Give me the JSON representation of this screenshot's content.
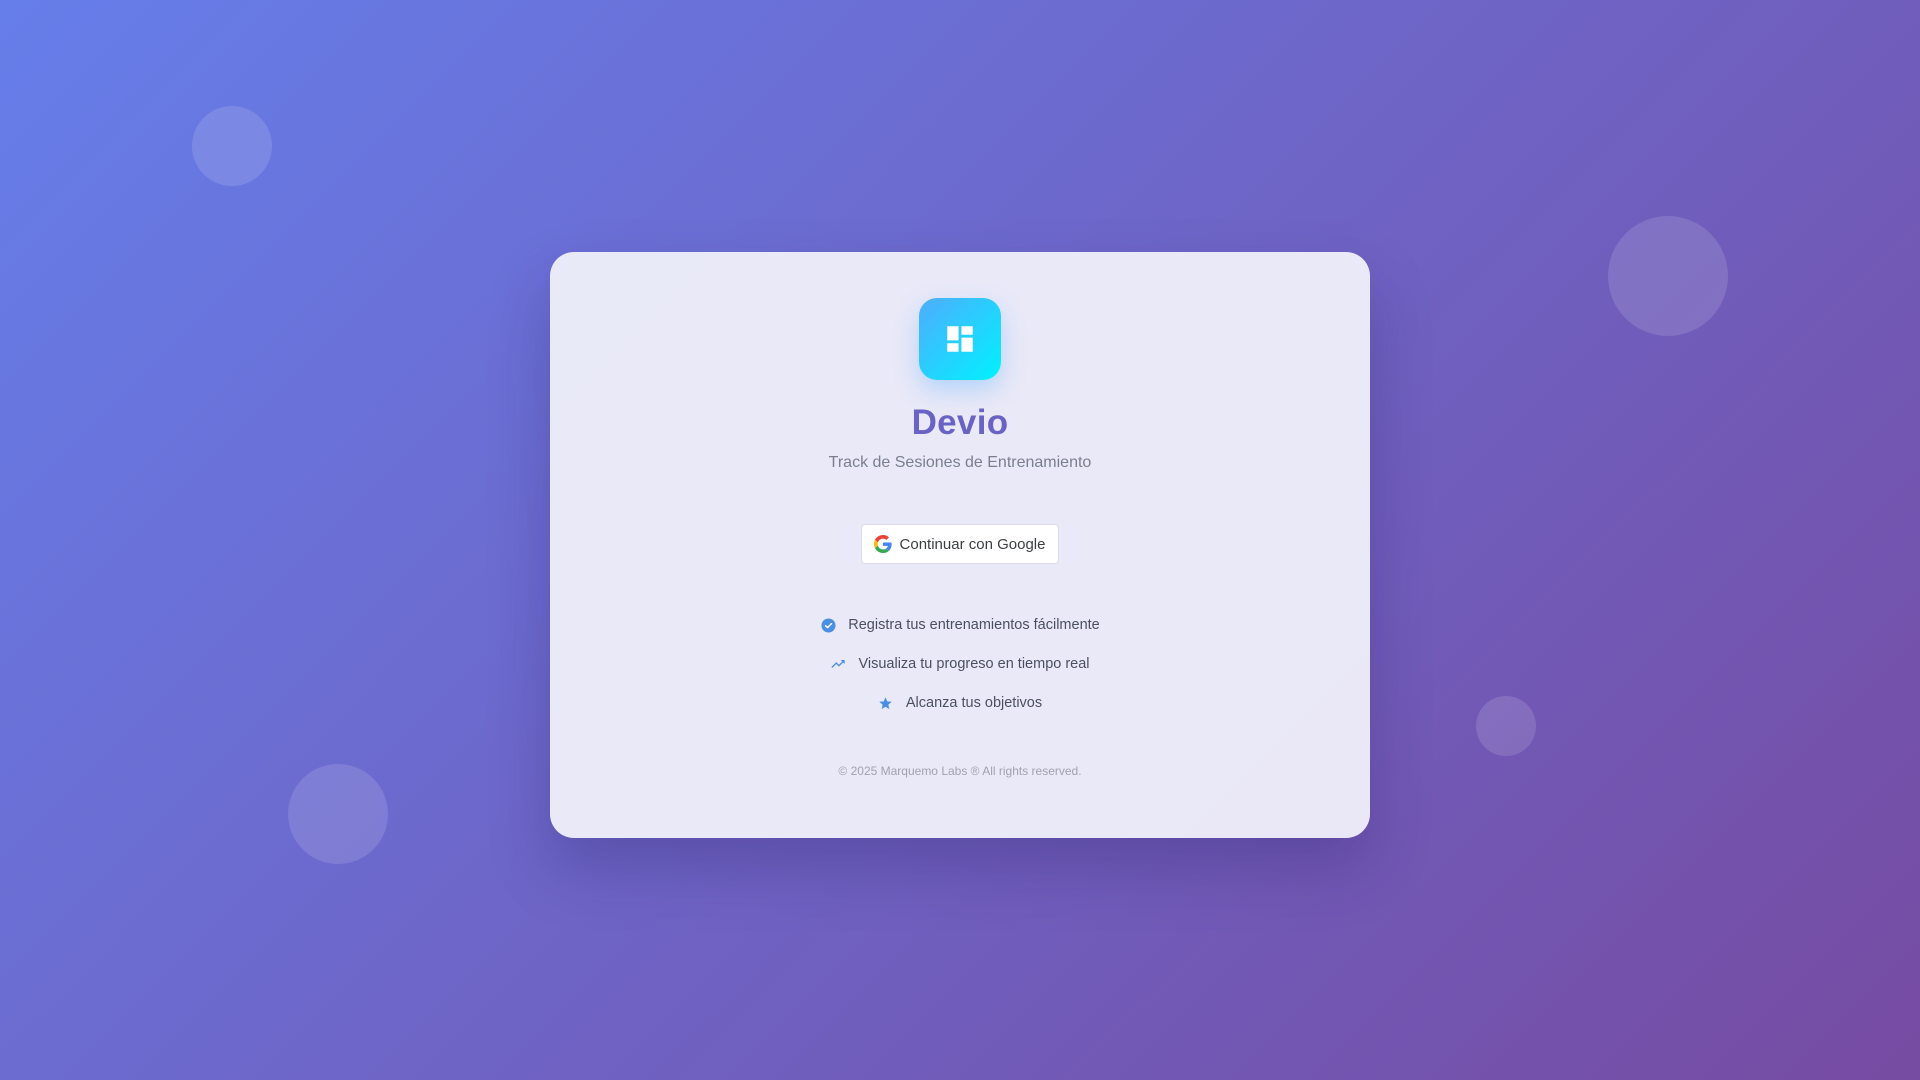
{
  "app": {
    "name": "Devio",
    "subtitle": "Track de Sesiones de Entrenamiento",
    "logo_icon": "dashboard-grid-icon"
  },
  "login": {
    "google_button_label": "Continuar con Google",
    "google_icon": "google-g-icon"
  },
  "features": [
    {
      "icon": "check-circle-icon",
      "text": "Registra tus entrenamientos fácilmente"
    },
    {
      "icon": "trending-up-icon",
      "text": "Visualiza tu progreso en tiempo real"
    },
    {
      "icon": "star-icon",
      "text": "Alcanza tus objetivos"
    }
  ],
  "footer": {
    "copyright": "© 2025 Marquemo Labs ® All rights reserved."
  },
  "colors": {
    "background_start": "#667eea",
    "background_end": "#764ba2",
    "title": "#6a63c6",
    "logo_gradient_start": "#4facfe",
    "logo_gradient_end": "#00f2fe",
    "feature_icon": "#4a90e2"
  }
}
